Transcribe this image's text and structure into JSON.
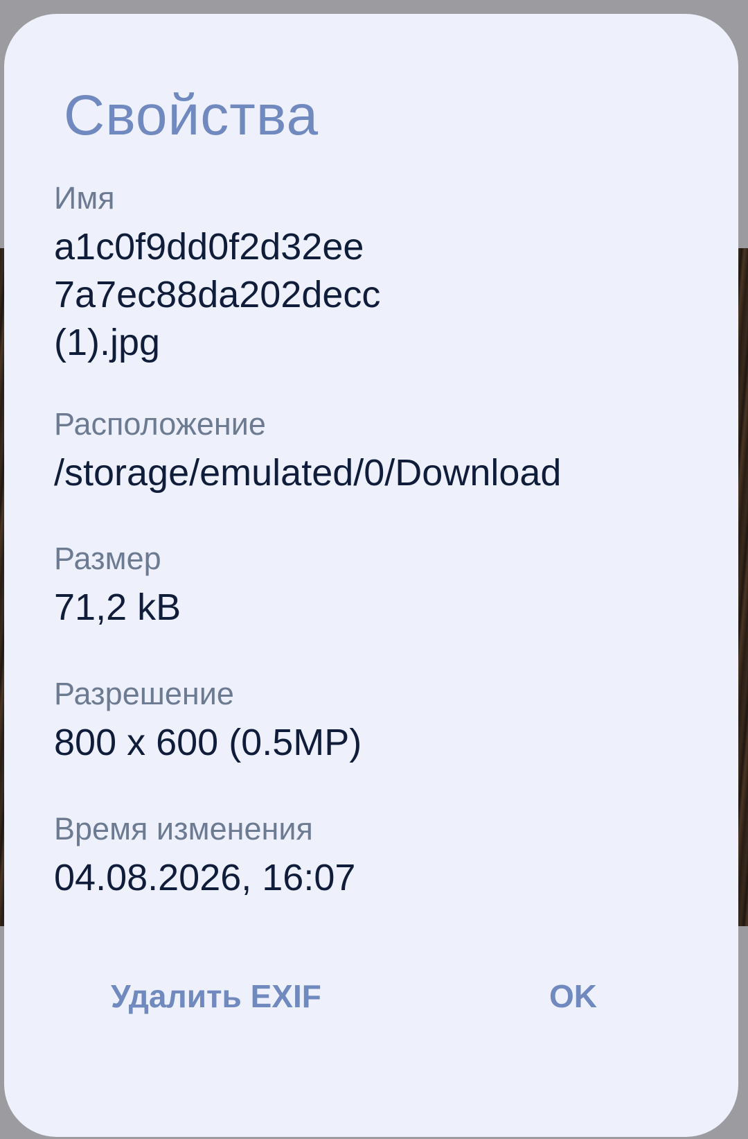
{
  "dialog": {
    "title": "Свойства",
    "fields": [
      {
        "label": "Имя",
        "value_lines": [
          "a1c0f9dd0f2d32ee",
          "7a7ec88da202decc",
          "(1).jpg"
        ]
      },
      {
        "label": "Расположение",
        "value": "/storage/emulated/0/Download"
      },
      {
        "label": "Размер",
        "value": "71,2 kB"
      },
      {
        "label": "Разрешение",
        "value": "800 x 600 (0.5MP)"
      },
      {
        "label": "Время изменения",
        "value": "04.08.2026, 16:07"
      }
    ],
    "buttons": {
      "remove_exif": "Удалить EXIF",
      "ok": "OK"
    }
  },
  "colors": {
    "dialog_background": "#eef0fc",
    "accent": "#7089bf",
    "label": "#6c7b92",
    "value": "#0f1d3a"
  }
}
